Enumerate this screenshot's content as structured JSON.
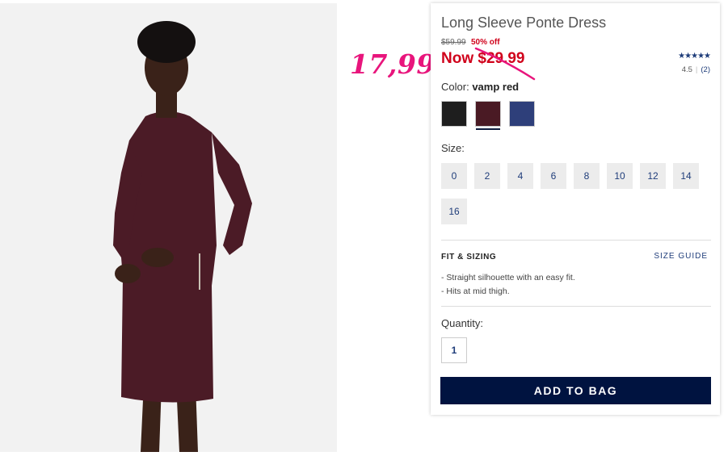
{
  "annotation": {
    "handwritten_price": "17,99",
    "color": "#e8157c"
  },
  "product": {
    "title": "Long Sleeve Ponte Dress",
    "original_price": "$59.99",
    "discount": "50% off",
    "now_price": "Now $29.99",
    "rating": {
      "stars": 4.5,
      "stars_icon": "★★★★★",
      "score": "4.5",
      "count": "(2)"
    },
    "color_label": "Color:",
    "color_value": "vamp red",
    "colors": [
      {
        "name": "black",
        "hex": "#1e1e1e",
        "selected": false
      },
      {
        "name": "vamp red",
        "hex": "#4a1a24",
        "selected": true
      },
      {
        "name": "navy",
        "hex": "#2e3f7a",
        "selected": false
      }
    ],
    "size_label": "Size:",
    "sizes": [
      "0",
      "2",
      "4",
      "6",
      "8",
      "10",
      "12",
      "14",
      "16"
    ],
    "fit_heading": "FIT & SIZING",
    "size_guide": "SIZE GUIDE",
    "fit_notes": [
      "- Straight silhouette with an easy fit.",
      "- Hits at mid thigh."
    ],
    "quantity_label": "Quantity:",
    "quantity": "1",
    "add_to_bag": "ADD TO BAG"
  },
  "colors": {
    "sale_red": "#d0021b",
    "brand_navy": "#001340",
    "link_blue": "#1f3d7a"
  }
}
